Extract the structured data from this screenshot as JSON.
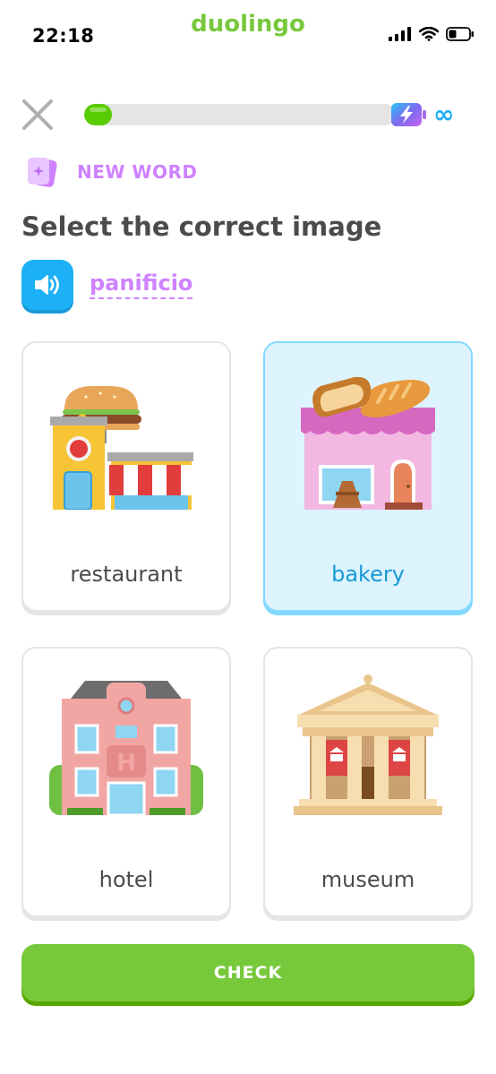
{
  "status_bar": {
    "time": "22:18",
    "app_name": "duolingo"
  },
  "lesson": {
    "progress": 0.09,
    "energy": "∞",
    "badge": "NEW WORD",
    "prompt": "Select the correct image",
    "word": "panificio"
  },
  "choices": [
    {
      "label": "restaurant",
      "icon": "restaurant-icon",
      "selected": false
    },
    {
      "label": "bakery",
      "icon": "bakery-icon",
      "selected": true
    },
    {
      "label": "hotel",
      "icon": "hotel-icon",
      "selected": false
    },
    {
      "label": "museum",
      "icon": "museum-icon",
      "selected": false
    }
  ],
  "actions": {
    "check_label": "CHECK"
  },
  "colors": {
    "brand_green": "#78c83c",
    "progress_green": "#58cc02",
    "accent_blue": "#1cb0f6",
    "accent_purple": "#ce82ff",
    "selected_bg": "#ddf4ff"
  }
}
